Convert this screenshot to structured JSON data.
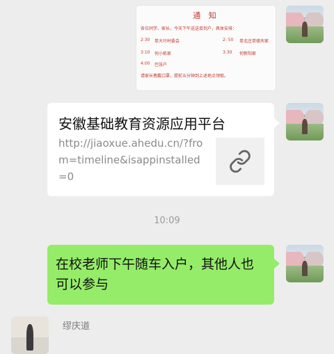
{
  "notice": {
    "title": "通 知",
    "intro": "各位同学、家长，今天下午送送目到户，具体安排：",
    "rows": [
      {
        "left_time": "2:30",
        "left_place": "单大圩村委会",
        "right_time": "2: 50",
        "right_place": "单北庄单德天家"
      },
      {
        "left_time": "3:10",
        "left_place": "何小栋家",
        "right_time": "3:30",
        "right_place": "何新阳家"
      },
      {
        "left_time": "4:00",
        "left_place": "巴张户",
        "right_time": "",
        "right_place": ""
      }
    ],
    "footer": "请家长携戴口罩，提前五分钟到上述地点领取。"
  },
  "link_card": {
    "title": "安徽基础教育资源应用平台",
    "url": "http://jiaoxue.ahedu.cn/?from=timeline&isappinstalled=0",
    "thumb_icon": "link-icon"
  },
  "timestamp": "10:09",
  "message": {
    "text": "在校老师下午随车入户，其他人也可以参与"
  },
  "incoming": {
    "sender_name": "缪庆道"
  },
  "colors": {
    "background": "#ededed",
    "outgoing_bubble": "#95ec69",
    "card_bubble": "#ffffff",
    "notice_text": "#c0392b"
  }
}
